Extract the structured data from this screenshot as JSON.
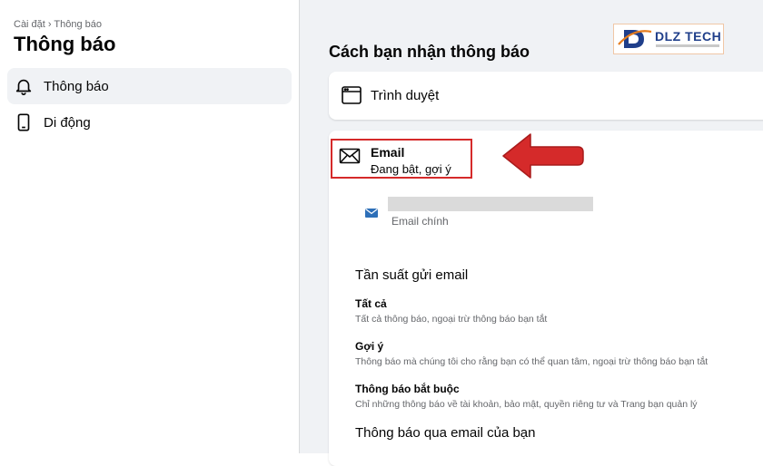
{
  "sidebar": {
    "breadcrumb": "Cài đặt › Thông báo",
    "title": "Thông báo",
    "items": [
      {
        "label": "Thông báo",
        "icon": "bell-icon",
        "active": true
      },
      {
        "label": "Di động",
        "icon": "mobile-phone-icon",
        "active": false
      }
    ]
  },
  "main": {
    "section_title": "Cách bạn nhận thông báo",
    "browser": {
      "label": "Trình duyệt",
      "icon": "browser-window-icon"
    },
    "email": {
      "title": "Email",
      "status": "Đang bật, gợi ý",
      "icon": "envelope-icon",
      "address_label": "Email chính"
    },
    "frequency": {
      "heading": "Tần suất gửi email",
      "options": [
        {
          "title": "Tất cả",
          "desc": "Tất cả thông báo, ngoại trừ thông báo bạn tắt"
        },
        {
          "title": "Gợi ý",
          "desc": "Thông báo mà chúng tôi cho rằng bạn có thể quan tâm, ngoại trừ thông báo bạn tắt"
        },
        {
          "title": "Thông báo bắt buộc",
          "desc": "Chỉ những thông báo về tài khoản, bảo mật, quyền riêng tư và Trang bạn quản lý"
        }
      ]
    },
    "your_email_heading": "Thông báo qua email của bạn"
  },
  "overlay": {
    "logo_text": "DLZ TECH",
    "highlight_color": "#d52a2a",
    "arrow_color": "#d52a2a"
  }
}
